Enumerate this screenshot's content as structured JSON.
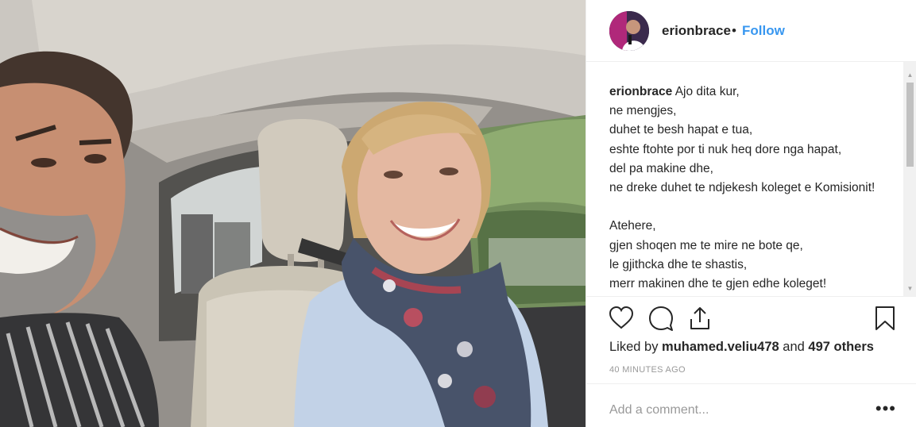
{
  "post": {
    "photo_alt": "",
    "header": {
      "username": "erionbrace",
      "separator": "•",
      "follow_label": "Follow"
    },
    "caption": {
      "username": "erionbrace",
      "text": "Ajo dita kur,\nne mengjes,\nduhet te besh hapat e tua,\neshte ftohte por ti nuk heq dore nga hapat,\ndel pa makine dhe,\nne dreke duhet te ndjekesh koleget e Komisionit!\n\nAtehere,\ngjen shoqen me te mire ne bote qe,\nle gjithcka dhe te shastis,\nmerr makinen dhe te gjen edhe koleget!"
    },
    "actions": {
      "icons": [
        "heart-icon",
        "comment-icon",
        "share-icon",
        "bookmark-icon"
      ]
    },
    "likes": {
      "prefix": "Liked by ",
      "liker": "muhamed.veliu478",
      "middle": " and ",
      "others": "497 others"
    },
    "timestamp": "40 MINUTES AGO",
    "comment": {
      "placeholder": "Add a comment...",
      "more_label": "•••"
    }
  },
  "colors": {
    "accent": "#3897f0",
    "text": "#262626",
    "muted": "#999999",
    "border": "#efefef"
  }
}
